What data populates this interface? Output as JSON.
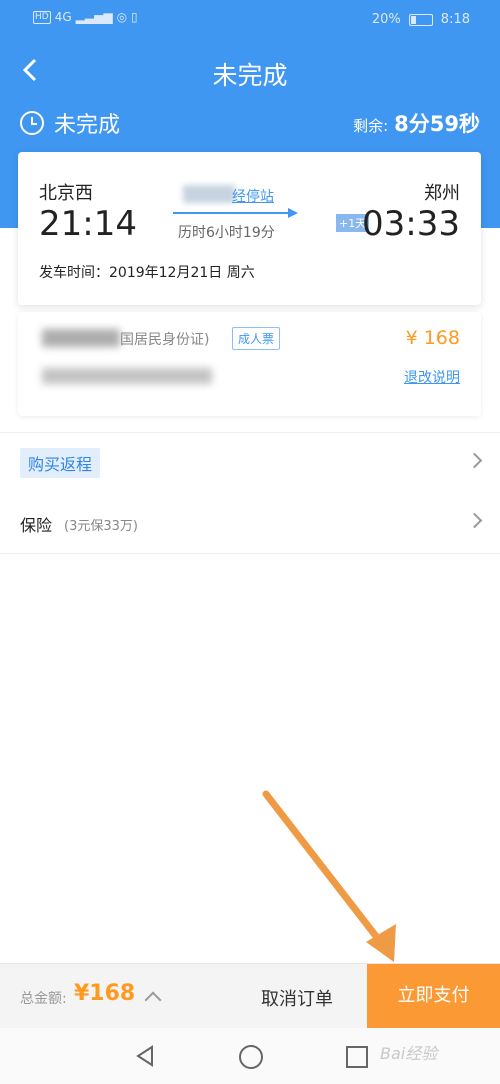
{
  "status_bar": {
    "hd": "HD",
    "net": "4G",
    "battery_pct": "20%",
    "time": "8:18"
  },
  "nav": {
    "title": "未完成"
  },
  "order_status": {
    "label": "未完成",
    "remaining_label": "剩余:",
    "remaining_value": "8分59秒"
  },
  "train": {
    "from_station": "北京西",
    "from_time": "21:14",
    "to_station": "郑州",
    "to_time": "03:33",
    "via_link": "经停站",
    "duration": "历时6小时19分",
    "plus_day": "+1天",
    "depart_date": "发车时间：2019年12月21日 周六"
  },
  "passenger": {
    "id_type": "国居民身份证)",
    "ticket_type": "成人票",
    "price": "¥ 168",
    "refund_link": "退改说明"
  },
  "rows": {
    "return_trip": "购买返程",
    "insurance_label": "保险",
    "insurance_note": "(3元保33万)"
  },
  "bottom": {
    "total_label": "总金额:",
    "total_value": "¥168",
    "cancel_label": "取消订单",
    "pay_label": "立即支付"
  },
  "watermark": "Bai经验",
  "colors": {
    "primary": "#3f97f1",
    "accent": "#fb9a34",
    "price": "#ff9a1f"
  }
}
